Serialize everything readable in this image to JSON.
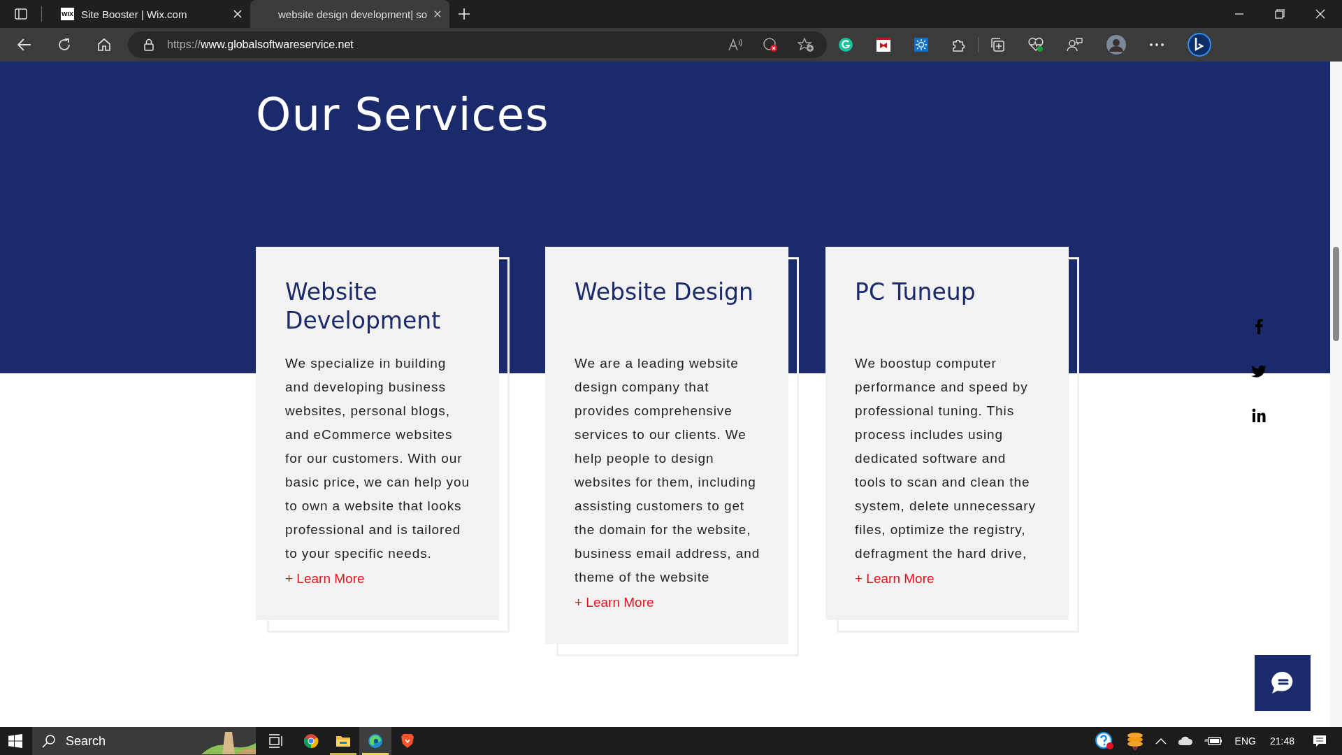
{
  "browser": {
    "tabs": [
      {
        "title": "Site Booster | Wix.com",
        "favicon": "WIX",
        "selected": false
      },
      {
        "title": "website design development| so",
        "selected": true
      }
    ],
    "url_scheme": "https://",
    "url_host": "www.globalsoftwareservice.net"
  },
  "page": {
    "heading": "Our Services",
    "cards": [
      {
        "title": "Website Development",
        "body": "We specialize in building and developing business websites, personal blogs, and eCommerce websites for our customers. With our basic price, we can help you to own a website that looks professional and is tailored to your specific needs.",
        "link": "+ Learn More"
      },
      {
        "title": "Website Design",
        "body": "We are a leading website design company that provides comprehensive services to our clients. We help people to design websites for them, including assisting customers to get the domain for the website, business email address, and theme of the website",
        "link": "+ Learn More"
      },
      {
        "title": "PC Tuneup",
        "body": "We boostup computer performance and speed by professional tuning. This process includes using dedicated software and tools to scan and clean the system, delete unnecessary files, optimize the registry, defragment the hard drive,",
        "link": "+ Learn More"
      }
    ]
  },
  "taskbar": {
    "search_placeholder": "Search",
    "apps": [
      {
        "kind": "chrome",
        "running": false,
        "selected": false
      },
      {
        "kind": "explorer",
        "running": true,
        "selected": false
      },
      {
        "kind": "edge",
        "running": true,
        "selected": true
      },
      {
        "kind": "brave",
        "running": false,
        "selected": false
      }
    ],
    "language": "ENG",
    "time": "21:48"
  }
}
